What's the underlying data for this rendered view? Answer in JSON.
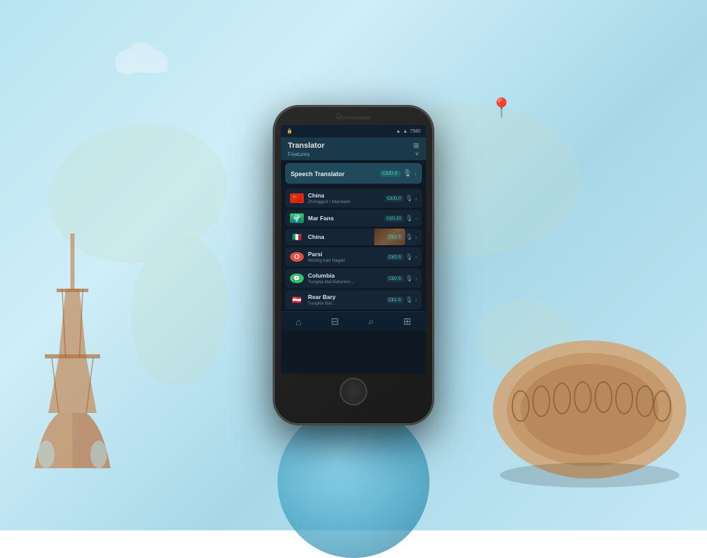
{
  "background": {
    "color_top": "#b8e4f0",
    "color_bottom": "#a8d8e8"
  },
  "phone": {
    "status_bar": {
      "left": "🔒",
      "time": "7580",
      "icons": "◼ ◼ ▲ ▲"
    },
    "header": {
      "title": "Translator",
      "icon": "⊞",
      "subtitle": "Features",
      "chevron": "∨"
    },
    "featured": {
      "label": "Speech Translator",
      "badge": "C£/D.0",
      "mic_icon": "🎙",
      "arrow": ">"
    },
    "list_items": [
      {
        "id": "china",
        "flag_emoji": "🇨🇳",
        "flag_color_top": "#de2910",
        "flag_color_bottom": "#de2910",
        "name": "China",
        "subtitle": "Zhōngguó / Mandarin",
        "badge": "C£/D.0",
        "has_image": false
      },
      {
        "id": "mar-fans",
        "flag_emoji": "🌍",
        "flag_color_top": "#2ecc71",
        "flag_color_bottom": "#27ae60",
        "name": "Mar Fans",
        "subtitle": "",
        "badge": "C£0.10"
      },
      {
        "id": "china2",
        "flag_emoji": "🇮🇹",
        "flag_color_top": "#009246",
        "flag_color_bottom": "#ce2b37",
        "name": "China",
        "subtitle": "",
        "badge": "C£1.S",
        "has_image": true
      },
      {
        "id": "parsi",
        "flag_emoji": "🅾",
        "flag_color_top": "#e74c3c",
        "flag_color_bottom": "#c0392b",
        "name": "Parsi",
        "subtitle": "Writing bad Nagari",
        "badge": "C£0.S"
      },
      {
        "id": "columbia",
        "flag_emoji": "💬",
        "flag_color_top": "#25d366",
        "flag_color_bottom": "#128c7e",
        "name": "Columbia",
        "subtitle": "Tungkia Bal Bafunten...",
        "badge": "C£0.S"
      },
      {
        "id": "rear-bary",
        "flag_emoji": "🇦🇹",
        "flag_color_top": "#ed2939",
        "flag_color_bottom": "#ed2939",
        "name": "Rear Bary",
        "subtitle": "Tungkia Bal...",
        "badge": "C£1.S"
      }
    ],
    "bottom_nav": [
      {
        "icon": "⌂",
        "label": "home"
      },
      {
        "icon": "⊟",
        "label": "list"
      },
      {
        "icon": "⌕",
        "label": "search"
      },
      {
        "icon": "⊞",
        "label": "grid"
      }
    ]
  },
  "landmarks": {
    "eiffel_color": "#c4956a",
    "colosseum_color": "#d4a574",
    "globe_color1": "#7ecfec",
    "globe_color2": "#1a6e8a",
    "cloud_color": "#d0eef8",
    "pin_color": "#2a9d8f"
  }
}
